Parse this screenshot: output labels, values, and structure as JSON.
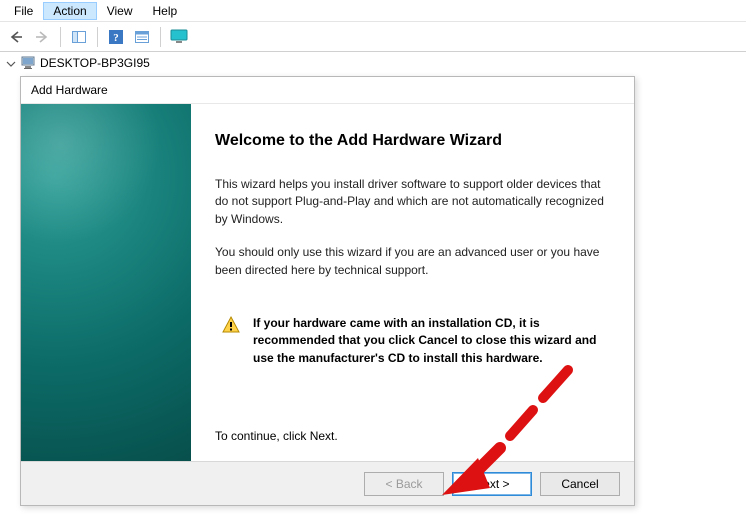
{
  "menubar": {
    "file": "File",
    "action": "Action",
    "view": "View",
    "help": "Help"
  },
  "toolbar": {
    "back": "back-arrow-icon",
    "forward": "forward-arrow-icon",
    "show_hide": "show-hide-tree-icon",
    "help": "help-icon",
    "properties": "properties-icon",
    "monitor": "monitor-icon"
  },
  "tree": {
    "root_label": "DESKTOP-BP3GI95"
  },
  "dialog": {
    "title": "Add Hardware",
    "heading": "Welcome to the Add Hardware Wizard",
    "para1": "This wizard helps you install driver software to support older devices that do not support Plug-and-Play and which are not automatically recognized by Windows.",
    "para2": "You should only use this wizard if you are an advanced user or you have been directed here by technical support.",
    "warning": "If your hardware came with an installation CD, it is recommended that you click Cancel to close this wizard and use the manufacturer's CD to install this hardware.",
    "continue_text": "To continue, click Next.",
    "buttons": {
      "back": "< Back",
      "next": "Next >",
      "cancel": "Cancel"
    }
  }
}
